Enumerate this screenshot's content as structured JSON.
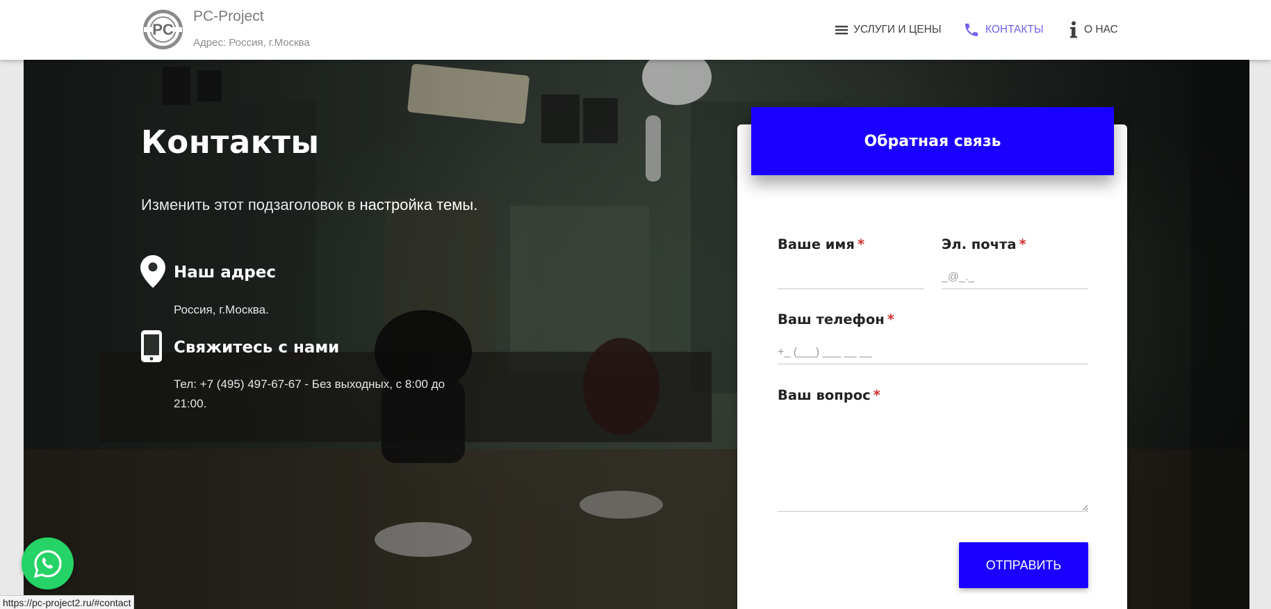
{
  "header": {
    "logo_text": "PC",
    "brand_name": "PC-Project",
    "brand_address": "Адрес: Россия, г.Москва"
  },
  "nav": {
    "items": [
      {
        "label": "Услуги и цены",
        "icon": "menu-icon"
      },
      {
        "label": "Контакты",
        "icon": "phone-icon",
        "active": true
      },
      {
        "label": "О нас",
        "icon": "info-icon"
      }
    ]
  },
  "hero": {
    "title": "Контакты",
    "subtitle_prefix": "Изменить этот подзаголовок в ",
    "subtitle_link": "настройка темы.",
    "address_heading": "Наш адрес",
    "address_text": "Россия, г.Москва.",
    "contact_heading": "Свяжитесь с нами",
    "contact_line1": "Тел: +7 (495) 497-67-67 - Без выходных, с 8:00 до",
    "contact_line2": "21:00."
  },
  "form": {
    "title": "Обратная связь",
    "name_label": "Ваше имя",
    "name_value": "",
    "email_label": "Эл. почта",
    "email_placeholder": "_@_._",
    "phone_label": "Ваш телефон",
    "phone_placeholder": "+_ (___) ___ __ __",
    "question_label": "Ваш вопрос",
    "question_value": "",
    "required_mark": "*",
    "submit_label": "Отправить"
  },
  "status_bar": {
    "url": "https://pc-project2.ru/#contact"
  },
  "colors": {
    "accent": "#1a00ff",
    "nav_active": "#6f5ff0",
    "whatsapp": "#25d366",
    "required": "#d23232"
  }
}
